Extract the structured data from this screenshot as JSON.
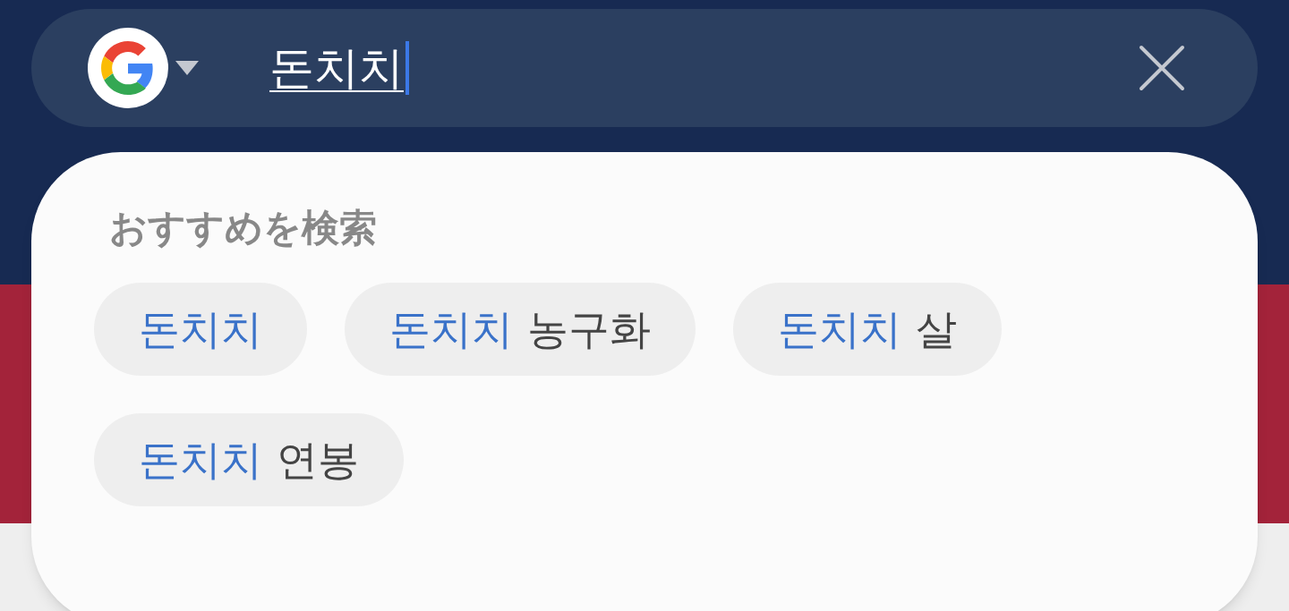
{
  "search": {
    "value": "돈치치"
  },
  "suggestions": {
    "heading": "おすすめを検索",
    "items": [
      {
        "match": "돈치치"
      },
      {
        "match": "돈치치",
        "rest": "농구화"
      },
      {
        "match": "돈치치",
        "rest": "살"
      },
      {
        "match": "돈치치",
        "rest": "연봉"
      }
    ]
  }
}
